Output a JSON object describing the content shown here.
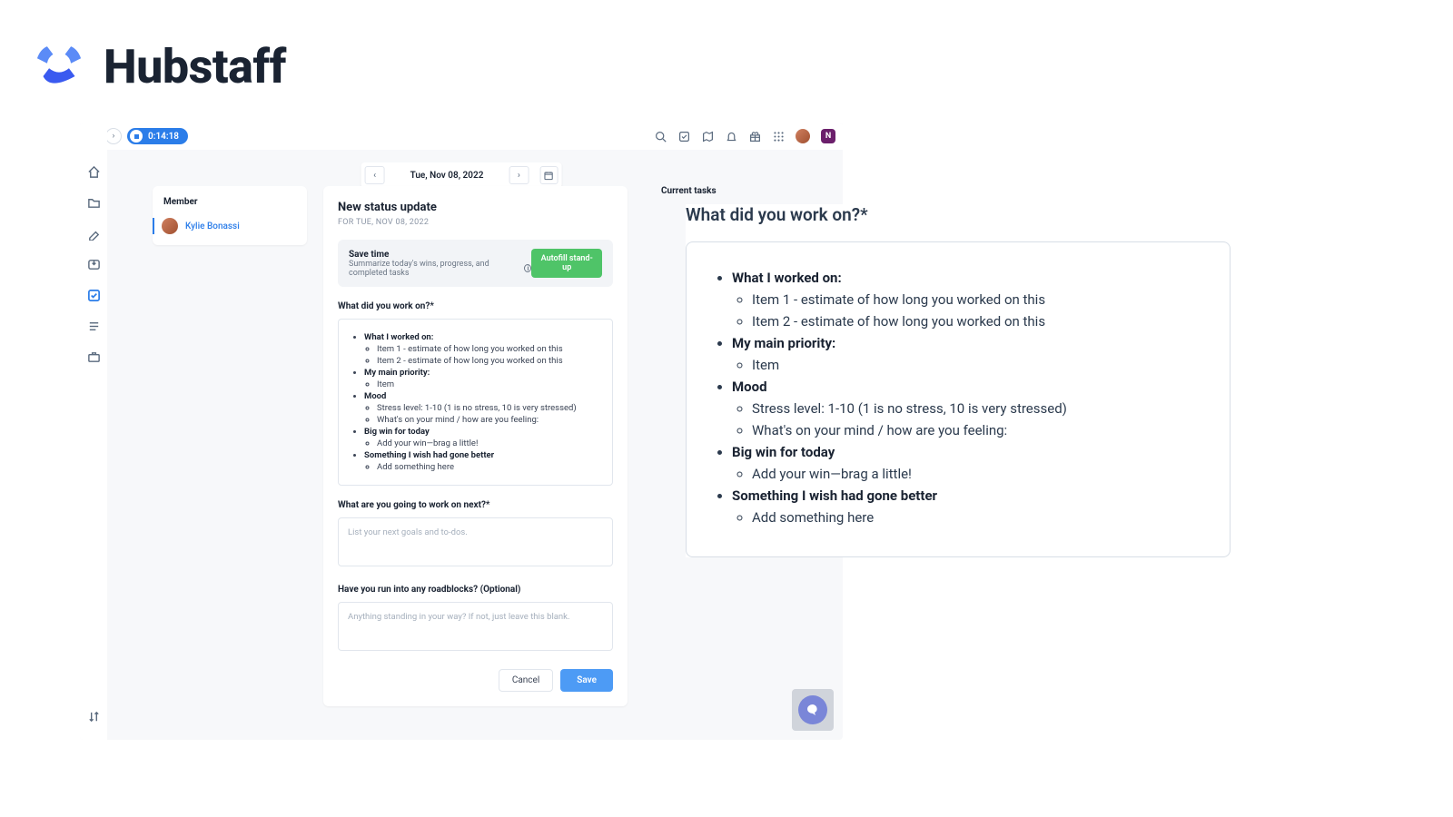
{
  "brand": {
    "name": "Hubstaff"
  },
  "topbar": {
    "timer": "0:14:18",
    "avatar_initial": "N"
  },
  "date_nav": {
    "date": "Tue, Nov 08, 2022"
  },
  "member_card": {
    "title": "Member",
    "member_name": "Kylie Bonassi"
  },
  "status_panel": {
    "title": "New status update",
    "date_line": "FOR TUE, NOV 08, 2022",
    "savetime": {
      "title": "Save time",
      "subtitle": "Summarize today's wins, progress, and completed tasks",
      "button": "Autofill stand-up"
    },
    "q1": "What did you work on?*",
    "content": {
      "h1": "What I worked on:",
      "h1_i1": "Item 1 - estimate of how long you worked on this",
      "h1_i2": "Item 2 - estimate of how long you worked on this",
      "h2": "My main priority:",
      "h2_i1": "Item",
      "h3": "Mood",
      "h3_i1": "Stress level: 1-10 (1 is no stress, 10 is very stressed)",
      "h3_i2": "What's on your mind / how are you feeling:",
      "h4": "Big win for today",
      "h4_i1": "Add your win—brag a little!",
      "h5": "Something I wish had gone better",
      "h5_i1": "Add something here"
    },
    "q2": "What are you going to work on next?*",
    "q2_placeholder": "List your next goals and to-dos.",
    "q3": "Have you run into any roadblocks? (Optional)",
    "q3_placeholder": "Anything standing in your way? If not, just leave this blank.",
    "cancel": "Cancel",
    "save": "Save"
  },
  "current_tasks_label": "Current tasks",
  "zoom": {
    "question": "What did you work on?*"
  }
}
